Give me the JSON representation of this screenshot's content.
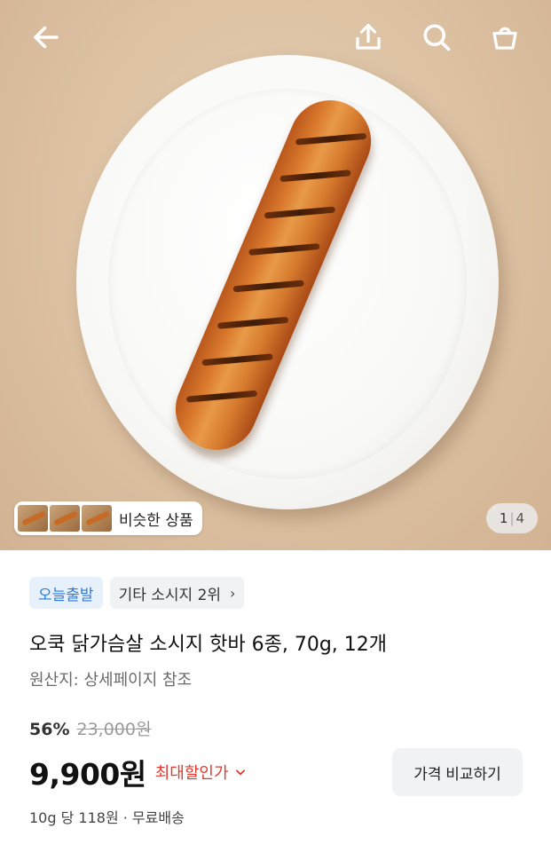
{
  "header": {
    "back_icon": "arrow-left-icon",
    "share_icon": "share-icon",
    "search_icon": "search-icon",
    "cart_icon": "shopping-bag-icon"
  },
  "gallery": {
    "similar_label": "비슷한 상품",
    "current": "1",
    "total": "4",
    "separator": "|"
  },
  "product": {
    "badges": {
      "delivery": "오늘출발",
      "rank": "기타 소시지 2위"
    },
    "title": "오쿡 닭가슴살 소시지 핫바 6종, 70g, 12개",
    "origin": "원산지: 상세페이지 참조",
    "discount": "56%",
    "original_price": "23,000원",
    "price": "9,900원",
    "max_discount_label": "최대할인가",
    "compare_button": "가격 비교하기",
    "unit_info": "10g 당 118원 · 무료배송"
  },
  "colors": {
    "accent_red": "#e0392f",
    "badge_blue": "#2f7ad9",
    "badge_blue_bg": "#e7f1fb"
  }
}
